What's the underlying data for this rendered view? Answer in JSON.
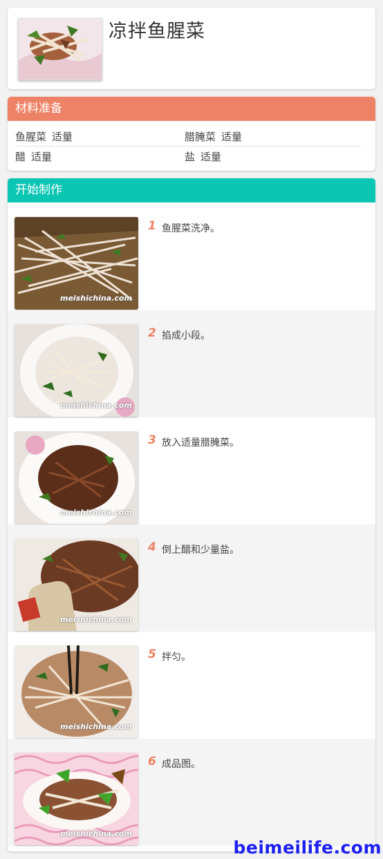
{
  "recipe": {
    "title": "凉拌鱼腥菜"
  },
  "ingredients": {
    "heading": "材料准备",
    "items": [
      {
        "name": "鱼腥菜",
        "amount": "适量"
      },
      {
        "name": "腊腌菜",
        "amount": "适量"
      },
      {
        "name": "醋",
        "amount": "适量"
      },
      {
        "name": "盐",
        "amount": "适量"
      }
    ]
  },
  "steps": {
    "heading": "开始制作",
    "watermark": "meishichina.com",
    "items": [
      {
        "num": "1",
        "text": "鱼腥菜洗净。",
        "image": "raw-fish-mint-stalks-on-bamboo-tray"
      },
      {
        "num": "2",
        "text": "掐成小段。",
        "image": "cut-stalks-in-white-bowl"
      },
      {
        "num": "3",
        "text": "放入适量腊腌菜。",
        "image": "pickled-vegetables-on-top"
      },
      {
        "num": "4",
        "text": "倒上醋和少量盐。",
        "image": "vinegar-bottle-pouring"
      },
      {
        "num": "5",
        "text": "拌匀。",
        "image": "mixed-with-chopsticks"
      },
      {
        "num": "6",
        "text": "成品图。",
        "image": "finished-dish-on-pink-plate"
      }
    ]
  },
  "footer": {
    "brand": "beimeilife.com"
  },
  "colors": {
    "ingredients_header": "#ee8266",
    "steps_header": "#0bc6b3",
    "step_number": "#ee8266",
    "brand": "#1d20ee"
  }
}
